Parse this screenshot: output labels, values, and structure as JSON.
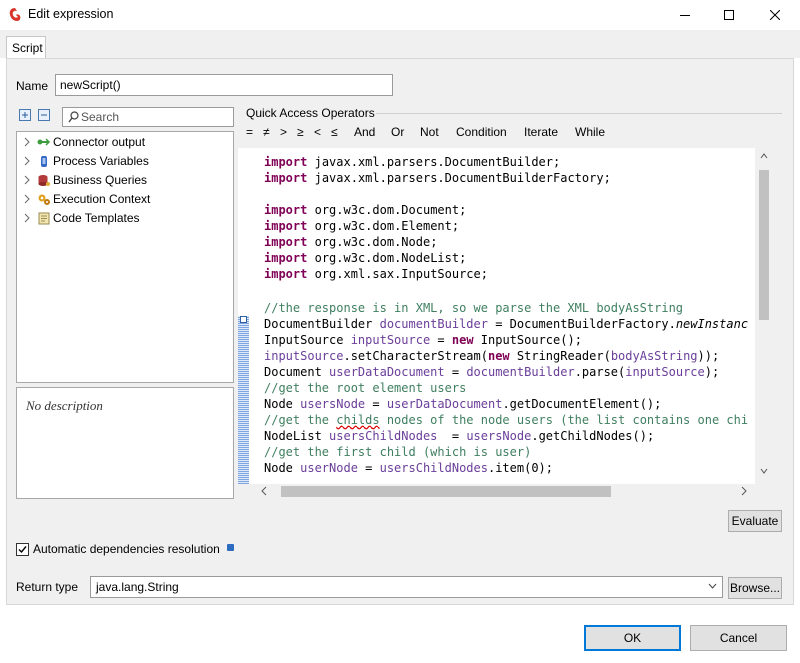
{
  "window": {
    "title": "Edit expression"
  },
  "tabs": [
    {
      "label": "Script"
    }
  ],
  "name_field": {
    "label": "Name",
    "value": "newScript()"
  },
  "search": {
    "placeholder": "Search"
  },
  "tree": {
    "items": [
      {
        "label": "Connector output",
        "icon": "connector-icon"
      },
      {
        "label": "Process Variables",
        "icon": "variable-icon"
      },
      {
        "label": "Business Queries",
        "icon": "database-icon"
      },
      {
        "label": "Execution Context",
        "icon": "context-icon"
      },
      {
        "label": "Code Templates",
        "icon": "template-icon"
      }
    ]
  },
  "description": {
    "text": "No description"
  },
  "quick_access": {
    "title": "Quick Access Operators",
    "operators": [
      "=",
      "≠",
      ">",
      "≥",
      "<",
      "≤",
      "And",
      "Or",
      "Not",
      "Condition",
      "Iterate",
      "While"
    ]
  },
  "code": {
    "lines": [
      "import javax.xml.parsers.DocumentBuilder;",
      "import javax.xml.parsers.DocumentBuilderFactory;",
      "",
      "import org.w3c.dom.Document;",
      "import org.w3c.dom.Element;",
      "import org.w3c.dom.Node;",
      "import org.w3c.dom.NodeList;",
      "import org.xml.sax.InputSource;",
      "",
      "//the response is in XML, so we parse the XML bodyAsString",
      "DocumentBuilder documentBuilder = DocumentBuilderFactory.newInstanc",
      "InputSource inputSource = new InputSource();",
      "inputSource.setCharacterStream(new StringReader(bodyAsString));",
      "Document userDataDocument = documentBuilder.parse(inputSource);",
      "//get the root element users",
      "Node usersNode = userDataDocument.getDocumentElement();",
      "//get the childs nodes of the node users (the list contains one chi",
      "NodeList usersChildNodes  = usersNode.getChildNodes();",
      "//get the first child (which is user)",
      "Node userNode = usersChildNodes.item(0);"
    ]
  },
  "buttons": {
    "evaluate": "Evaluate",
    "browse": "Browse...",
    "ok": "OK",
    "cancel": "Cancel"
  },
  "auto_dependencies": {
    "label": "Automatic dependencies resolution",
    "checked": true
  },
  "return_type": {
    "label": "Return type",
    "value": "java.lang.String"
  },
  "colors": {
    "keyword": "#7f0055",
    "comment": "#3f7f5f",
    "variable": "#6a3e9a",
    "ok_border": "#0078d7"
  }
}
